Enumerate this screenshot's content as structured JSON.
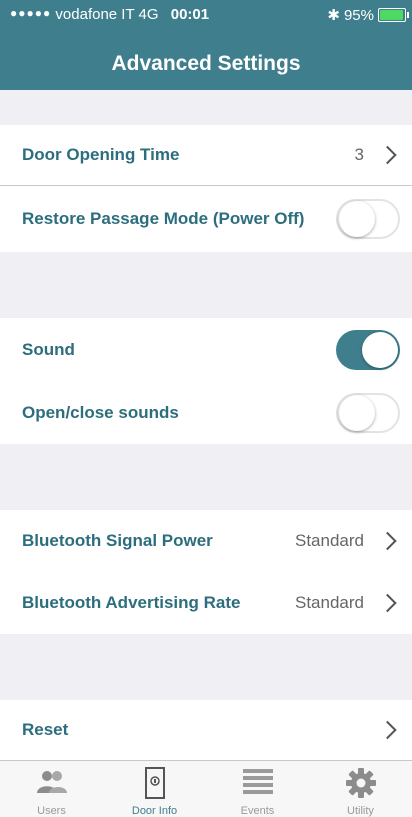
{
  "status_bar": {
    "signal": "●●●●●",
    "carrier": "vodafone IT",
    "network": "4G",
    "time": "00:01",
    "bluetooth": "✱",
    "battery": "95%",
    "battery_level": 0.95
  },
  "header": {
    "title": "Advanced Settings"
  },
  "settings": {
    "door_opening_time": {
      "label": "Door Opening Time",
      "value": "3"
    },
    "restore_passage_mode": {
      "label": "Restore Passage Mode (Power Off)",
      "on": false
    },
    "sound": {
      "label": "Sound",
      "on": true
    },
    "open_close_sounds": {
      "label": "Open/close sounds",
      "on": false
    },
    "bluetooth_signal_power": {
      "label": "Bluetooth Signal Power",
      "value": "Standard"
    },
    "bluetooth_advertising_rate": {
      "label": "Bluetooth Advertising Rate",
      "value": "Standard"
    },
    "reset": {
      "label": "Reset"
    }
  },
  "tabbar": {
    "items": [
      {
        "label": "Users",
        "icon": "users-icon"
      },
      {
        "label": "Door Info",
        "icon": "door-icon"
      },
      {
        "label": "Events",
        "icon": "list-icon"
      },
      {
        "label": "Utility",
        "icon": "gear-icon"
      }
    ],
    "active_index": 1
  },
  "colors": {
    "accent": "#3f7f8d",
    "label": "#2d6e7e",
    "background": "#efeff4"
  }
}
